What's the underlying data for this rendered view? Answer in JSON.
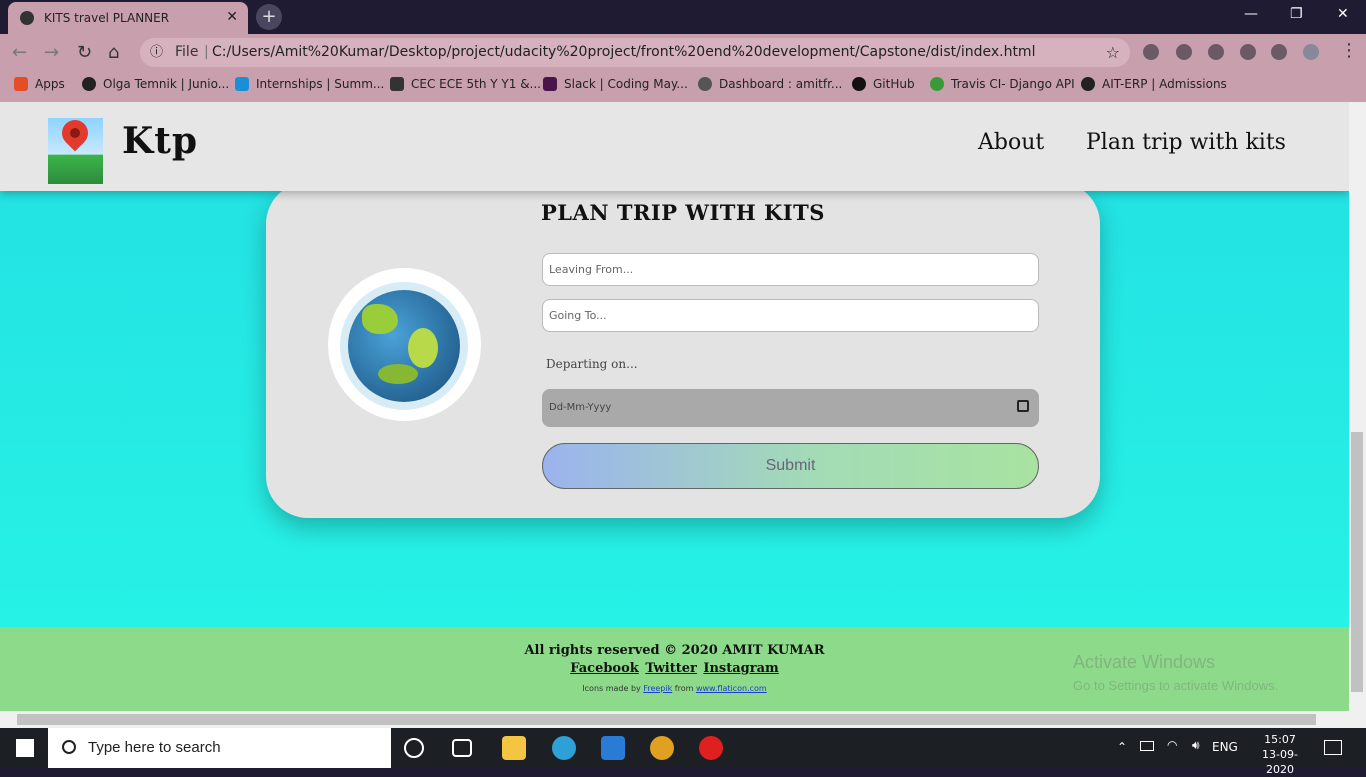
{
  "browser": {
    "tab_title": "KITS travel PLANNER",
    "tab_close": "✕",
    "new_tab": "+",
    "address": {
      "file_label": "File",
      "url": "C:/Users/Amit%20Kumar/Desktop/project/udacity%20project/front%20end%20development/Capstone/dist/index.html"
    },
    "bookmarks": [
      {
        "label": "Apps",
        "color": "#e44d26"
      },
      {
        "label": "Olga Temnik | Junio...",
        "color": "#222222"
      },
      {
        "label": "Internships | Summ...",
        "color": "#1a8fd8"
      },
      {
        "label": "CEC ECE 5th Y Y1 &...",
        "color": "#333333"
      },
      {
        "label": "Slack | Coding May...",
        "color": "#4a154b"
      },
      {
        "label": "Dashboard : amitfr...",
        "color": "#555555"
      },
      {
        "label": "GitHub",
        "color": "#111111"
      },
      {
        "label": "Travis CI- Django API",
        "color": "#3a9a3a"
      },
      {
        "label": "AIT-ERP | Admissions",
        "color": "#222222"
      }
    ]
  },
  "site": {
    "brand": "Ktp",
    "nav": [
      "About",
      "Plan trip with kits"
    ],
    "form": {
      "title": "PLAN TRIP WITH KITS",
      "leaving_placeholder": "Leaving From...",
      "going_placeholder": "Going To...",
      "depart_label": "Departing on...",
      "date_placeholder": "Dd-Mm-Yyyy",
      "submit_label": "Submit"
    },
    "footer": {
      "copyright": "All rights reserved © 2020 AMIT KUMAR",
      "social": [
        "Facebook",
        "Twitter",
        "Instagram"
      ],
      "credits_prefix": "Icons made by",
      "credits_author": "Freepik",
      "credits_mid": "from",
      "credits_site": "www.flaticon.com"
    }
  },
  "watermark": {
    "line1": "Activate Windows",
    "line2": "Go to Settings to activate Windows."
  },
  "taskbar": {
    "search_placeholder": "Type here to search",
    "lang": "ENG",
    "time": "15:07",
    "date": "13-09-2020"
  }
}
